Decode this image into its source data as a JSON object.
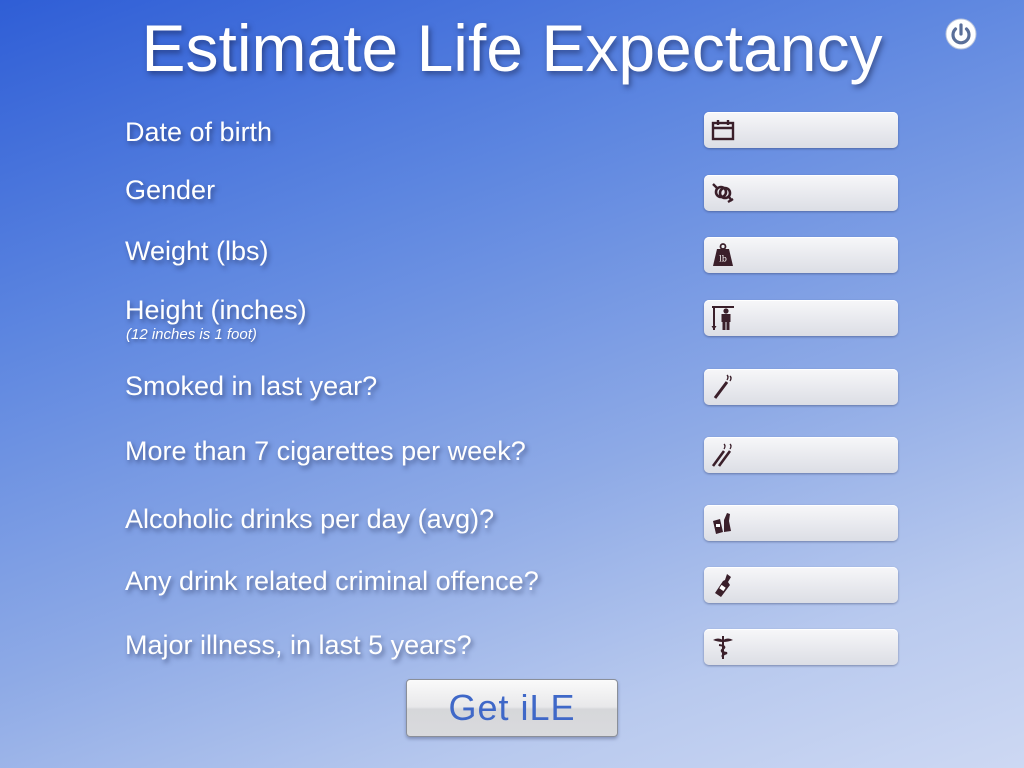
{
  "header": {
    "title": "Estimate Life Expectancy",
    "power_icon": "power-icon"
  },
  "form": {
    "rows": [
      {
        "label": "Date of birth",
        "icon": "calendar-icon",
        "value": ""
      },
      {
        "label": "Gender",
        "icon": "gender-icon",
        "value": ""
      },
      {
        "label": "Weight (lbs)",
        "icon": "weight-icon",
        "value": ""
      },
      {
        "label": "Height (inches)",
        "note": "(12 inches is 1 foot)",
        "icon": "height-icon",
        "value": ""
      },
      {
        "label": "Smoked in last year?",
        "icon": "cigarette-icon",
        "value": ""
      },
      {
        "label": "More than 7 cigarettes per week?",
        "icon": "cigarettes-icon",
        "value": ""
      },
      {
        "label": "Alcoholic drinks per day (avg)?",
        "icon": "drinks-icon",
        "value": ""
      },
      {
        "label": "Any drink related criminal offence?",
        "icon": "bottle-icon",
        "value": ""
      },
      {
        "label": "Major illness, in last 5 years?",
        "icon": "caduceus-icon",
        "value": ""
      }
    ]
  },
  "actions": {
    "submit_label": "Get iLE"
  },
  "colors": {
    "background_top": "#2f5ed6",
    "background_bottom": "#cdd8f3",
    "button_text": "#3f68c8",
    "icon_color": "#3a1f2a"
  }
}
